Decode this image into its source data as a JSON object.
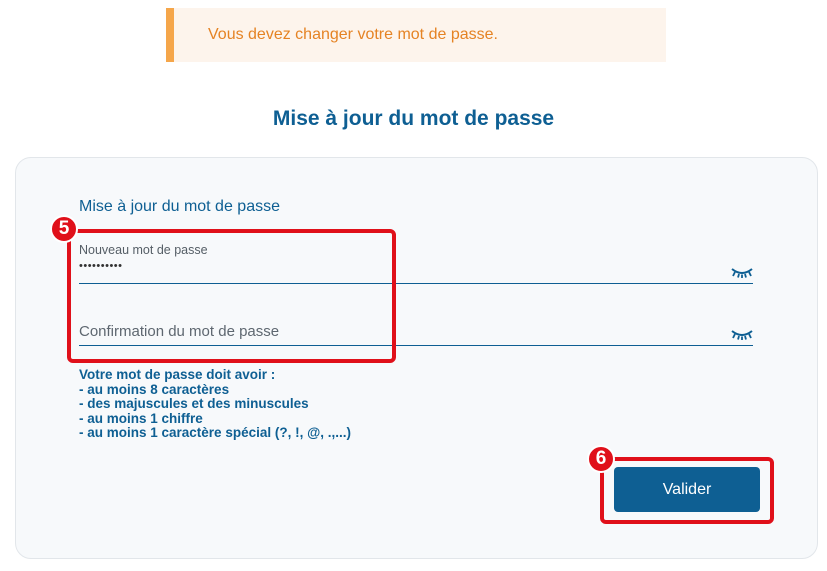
{
  "warning": {
    "message": "Vous devez changer votre mot de passe."
  },
  "page": {
    "title": "Mise à jour du mot de passe"
  },
  "form": {
    "section_title": "Mise à jour du mot de passe",
    "new_password": {
      "label": "Nouveau mot de passe",
      "value": "••••••••••"
    },
    "confirm_password": {
      "placeholder": "Confirmation du mot de passe",
      "value": ""
    },
    "toggle_icon": "eye-closed-icon",
    "rules": {
      "heading": "Votre mot de passe doit avoir :",
      "items": [
        "- au moins 8 caractères",
        "- des majuscules et des minuscules",
        "- au moins 1 chiffre",
        "- au moins 1 caractère spécial (?, !, @, .,...)"
      ]
    },
    "submit_label": "Valider"
  },
  "annotations": [
    {
      "number": "5",
      "target": "password-fields"
    },
    {
      "number": "6",
      "target": "validate-button"
    }
  ],
  "colors": {
    "primary": "#0e5f93",
    "warning_text": "#e58324",
    "warning_bg": "#fdf4ec",
    "warning_border": "#f5a64a",
    "annotation": "#e0101a"
  }
}
